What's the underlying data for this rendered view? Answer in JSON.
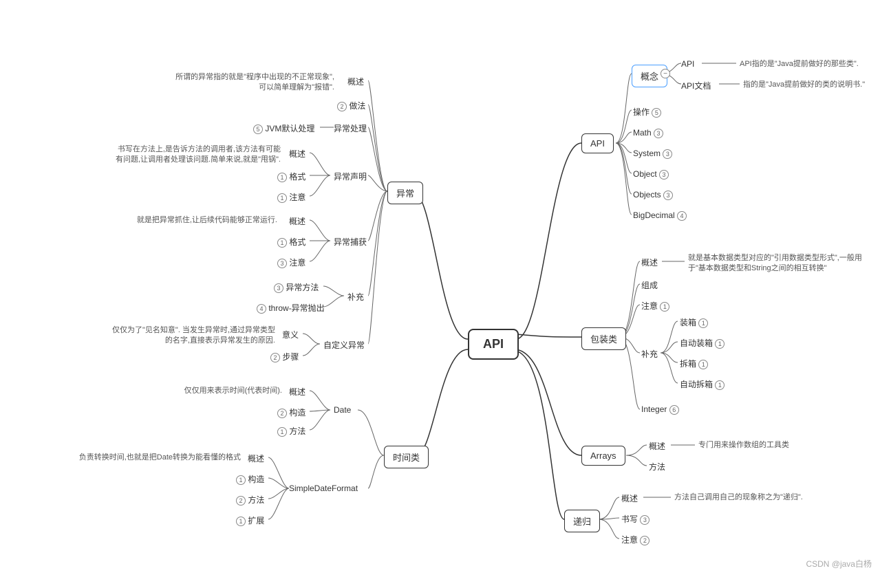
{
  "root": "API",
  "watermark": "CSDN @java白杨",
  "right": {
    "api": {
      "title": "API",
      "concept": {
        "label": "概念",
        "api": {
          "l": "API",
          "note": "API指的是\"Java提前做好的那些类\"."
        },
        "doc": {
          "l": "API文档",
          "note": "指的是\"Java提前做好的类的说明书.\""
        }
      },
      "operation": {
        "l": "操作",
        "n": "5"
      },
      "math": {
        "l": "Math",
        "n": "3"
      },
      "system": {
        "l": "System",
        "n": "3"
      },
      "object": {
        "l": "Object",
        "n": "3"
      },
      "objects": {
        "l": "Objects",
        "n": "3"
      },
      "bigdecimal": {
        "l": "BigDecimal",
        "n": "4"
      }
    },
    "wrapper": {
      "title": "包装类",
      "overview": {
        "l": "概述",
        "note": "就是基本数据类型对应的\"引用数据类型形式\",一般用于\"基本数据类型和String之间的相互转换\""
      },
      "compose": "组成",
      "notice": {
        "l": "注意",
        "n": "1"
      },
      "supplement": {
        "l": "补充",
        "box": {
          "l": "装箱",
          "n": "1"
        },
        "autobox": {
          "l": "自动装箱",
          "n": "1"
        },
        "unbox": {
          "l": "拆箱",
          "n": "1"
        },
        "autounbox": {
          "l": "自动拆箱",
          "n": "1"
        }
      },
      "integer": {
        "l": "Integer",
        "n": "6"
      }
    },
    "arrays": {
      "title": "Arrays",
      "overview": {
        "l": "概述",
        "note": "专门用来操作数组的工具类"
      },
      "method": "方法"
    },
    "recursion": {
      "title": "递归",
      "overview": {
        "l": "概述",
        "note": "方法自己调用自己的现象称之为\"递归\"."
      },
      "write": {
        "l": "书写",
        "n": "3"
      },
      "notice": {
        "l": "注意",
        "n": "2"
      }
    }
  },
  "left": {
    "exception": {
      "title": "异常",
      "overview": {
        "l": "概述",
        "note": "所谓的异常指的就是\"程序中出现的不正常现象\",可以简单理解为\"报错\"."
      },
      "method": {
        "l": "做法",
        "n": "2"
      },
      "handle": {
        "l": "异常处理",
        "jvm": {
          "l": "JVM默认处理",
          "n": "5"
        }
      },
      "declare": {
        "l": "异常声明",
        "overview": {
          "l": "概述",
          "note": "书写在方法上,是告诉方法的调用者,该方法有可能有问题,让调用者处理该问题.简单来说,就是\"甩锅\"."
        },
        "format": {
          "l": "格式",
          "n": "1"
        },
        "notice": {
          "l": "注意",
          "n": "1"
        }
      },
      "catch": {
        "l": "异常捕获",
        "overview": {
          "l": "概述",
          "note": "就是把异常抓住,让后续代码能够正常运行."
        },
        "format": {
          "l": "格式",
          "n": "1"
        },
        "notice": {
          "l": "注意",
          "n": "3"
        }
      },
      "supplement": {
        "l": "补充",
        "method": {
          "l": "异常方法",
          "n": "3"
        },
        "throw": {
          "l": "throw-异常抛出",
          "n": "4"
        }
      },
      "custom": {
        "l": "自定义异常",
        "meaning": {
          "l": "意义",
          "note": "仅仅为了\"见名知意\". 当发生异常时,通过异常类型的名字,直接表示异常发生的原因."
        },
        "step": {
          "l": "步骤",
          "n": "2"
        }
      }
    },
    "time": {
      "title": "时间类",
      "date": {
        "l": "Date",
        "overview": {
          "l": "概述",
          "note": "仅仅用来表示时间(代表时间)."
        },
        "construct": {
          "l": "构造",
          "n": "2"
        },
        "method": {
          "l": "方法",
          "n": "1"
        }
      },
      "sdf": {
        "l": "SimpleDateFormat",
        "overview": {
          "l": "概述",
          "note": "负责转换时间,也就是把Date转换为能看懂的格式"
        },
        "construct": {
          "l": "构造",
          "n": "1"
        },
        "method": {
          "l": "方法",
          "n": "2"
        },
        "extend": {
          "l": "扩展",
          "n": "1"
        }
      }
    }
  }
}
